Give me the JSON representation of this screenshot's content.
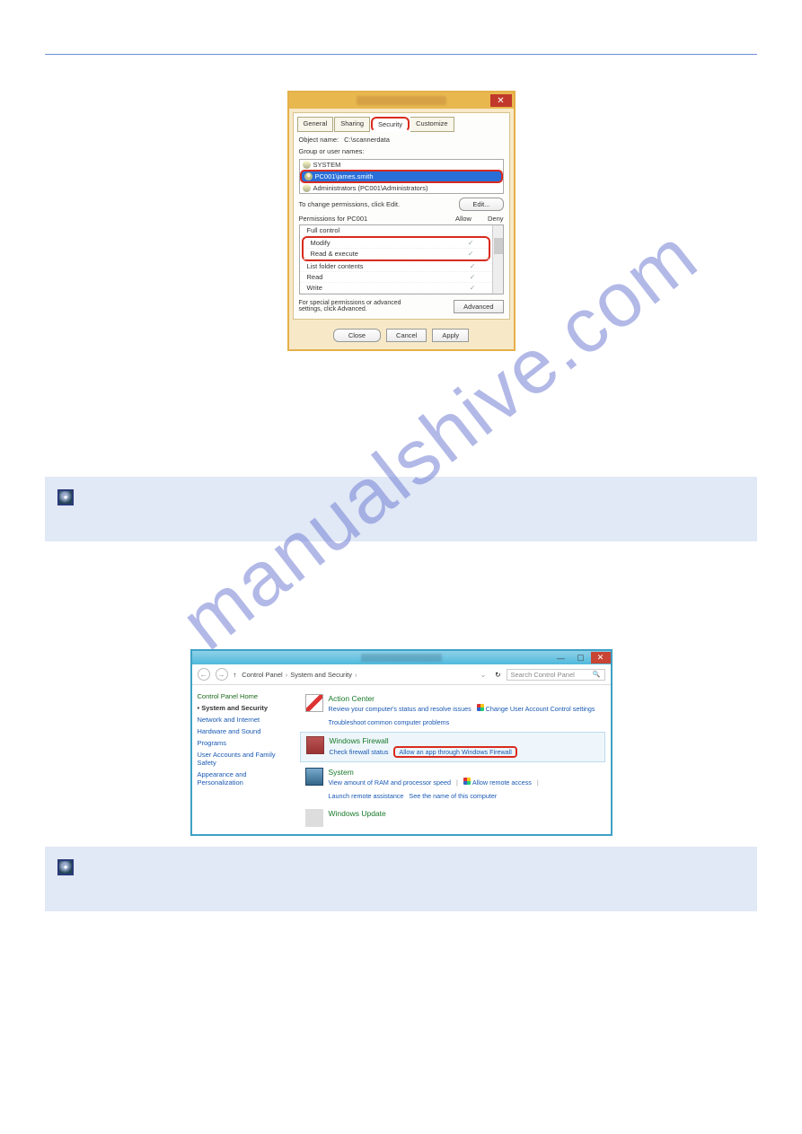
{
  "watermark": "manualshive.com",
  "dialog1": {
    "close_x": "✕",
    "tabs": {
      "general": "General",
      "sharing": "Sharing",
      "security": "Security",
      "customize": "Customize"
    },
    "object_name_label": "Object name:",
    "object_name_value": "C:\\scannerdata",
    "group_label": "Group or user names:",
    "users": [
      {
        "name": "SYSTEM",
        "selected": false
      },
      {
        "name": "PC001\\james.smith",
        "selected": true
      },
      {
        "name": "Administrators (PC001\\Administrators)",
        "selected": false
      }
    ],
    "change_text": "To change permissions, click Edit.",
    "edit_btn": "Edit...",
    "perm_header_label": "Permissions for PC001",
    "perm_allow": "Allow",
    "perm_deny": "Deny",
    "perms": [
      {
        "name": "Full control",
        "allow": false
      },
      {
        "name": "Modify",
        "allow": true
      },
      {
        "name": "Read & execute",
        "allow": true
      },
      {
        "name": "List folder contents",
        "allow": true
      },
      {
        "name": "Read",
        "allow": true
      },
      {
        "name": "Write",
        "allow": true
      }
    ],
    "advanced_text": "For special permissions or advanced settings, click Advanced.",
    "advanced_btn": "Advanced",
    "close_btn": "Close",
    "cancel_btn": "Cancel",
    "apply_btn": "Apply"
  },
  "note1": {
    "text": ""
  },
  "window2": {
    "titlebar": {
      "min": "—",
      "max": "▢",
      "close": "✕"
    },
    "nav": {
      "back": "←",
      "fwd": "→",
      "up": "↑",
      "breadcrumb": [
        "Control Panel",
        "System and Security"
      ],
      "refresh": "↻",
      "search_placeholder": "Search Control Panel",
      "search_icon": "🔍"
    },
    "sidebar": {
      "home": "Control Panel Home",
      "items": [
        "System and Security",
        "Network and Internet",
        "Hardware and Sound",
        "Programs",
        "User Accounts and Family Safety",
        "Appearance and Personalization"
      ]
    },
    "categories": [
      {
        "title": "Action Center",
        "links": [
          "Review your computer's status and resolve issues",
          "Change User Account Control settings",
          "Troubleshoot common computer problems"
        ],
        "shield_on": [
          1
        ]
      },
      {
        "title": "Windows Firewall",
        "links": [
          "Check firewall status",
          "Allow an app through Windows Firewall"
        ],
        "highlighted_link": 1
      },
      {
        "title": "System",
        "links": [
          "View amount of RAM and processor speed",
          "Allow remote access",
          "Launch remote assistance",
          "See the name of this computer"
        ],
        "shield_on": [
          1
        ]
      },
      {
        "title": "Windows Update",
        "links": []
      }
    ]
  }
}
